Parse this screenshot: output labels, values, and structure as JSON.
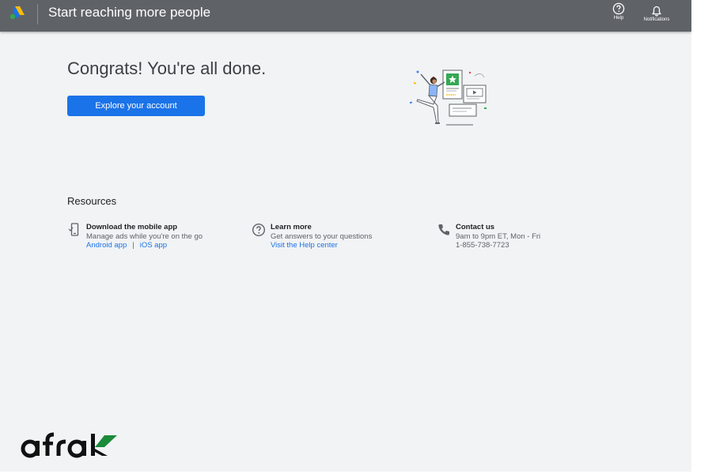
{
  "header": {
    "title": "Start reaching more people",
    "help_label": "Help",
    "notifications_label": "Notifications"
  },
  "main": {
    "heading": "Congrats! You're all done.",
    "explore_button": "Explore your account"
  },
  "resources": {
    "title": "Resources",
    "items": [
      {
        "icon": "mobile-phone-icon",
        "title": "Download the mobile app",
        "description": "Manage ads while you're on the go",
        "links": [
          "Android app",
          "iOS app"
        ],
        "separator": "|"
      },
      {
        "icon": "help-circle-icon",
        "title": "Learn more",
        "description": "Get answers to your questions",
        "links": [
          "Visit the Help center"
        ]
      },
      {
        "icon": "phone-icon",
        "title": "Contact us",
        "description": "9am to 9pm ET, Mon - Fri",
        "phone": "1-855-738-7723"
      }
    ]
  },
  "watermark": {
    "text": "afrak"
  },
  "colors": {
    "header_bg": "#5f6368",
    "page_bg": "#f1f3f4",
    "primary": "#1a73e8",
    "watermark_accent": "#1b8a3a"
  }
}
